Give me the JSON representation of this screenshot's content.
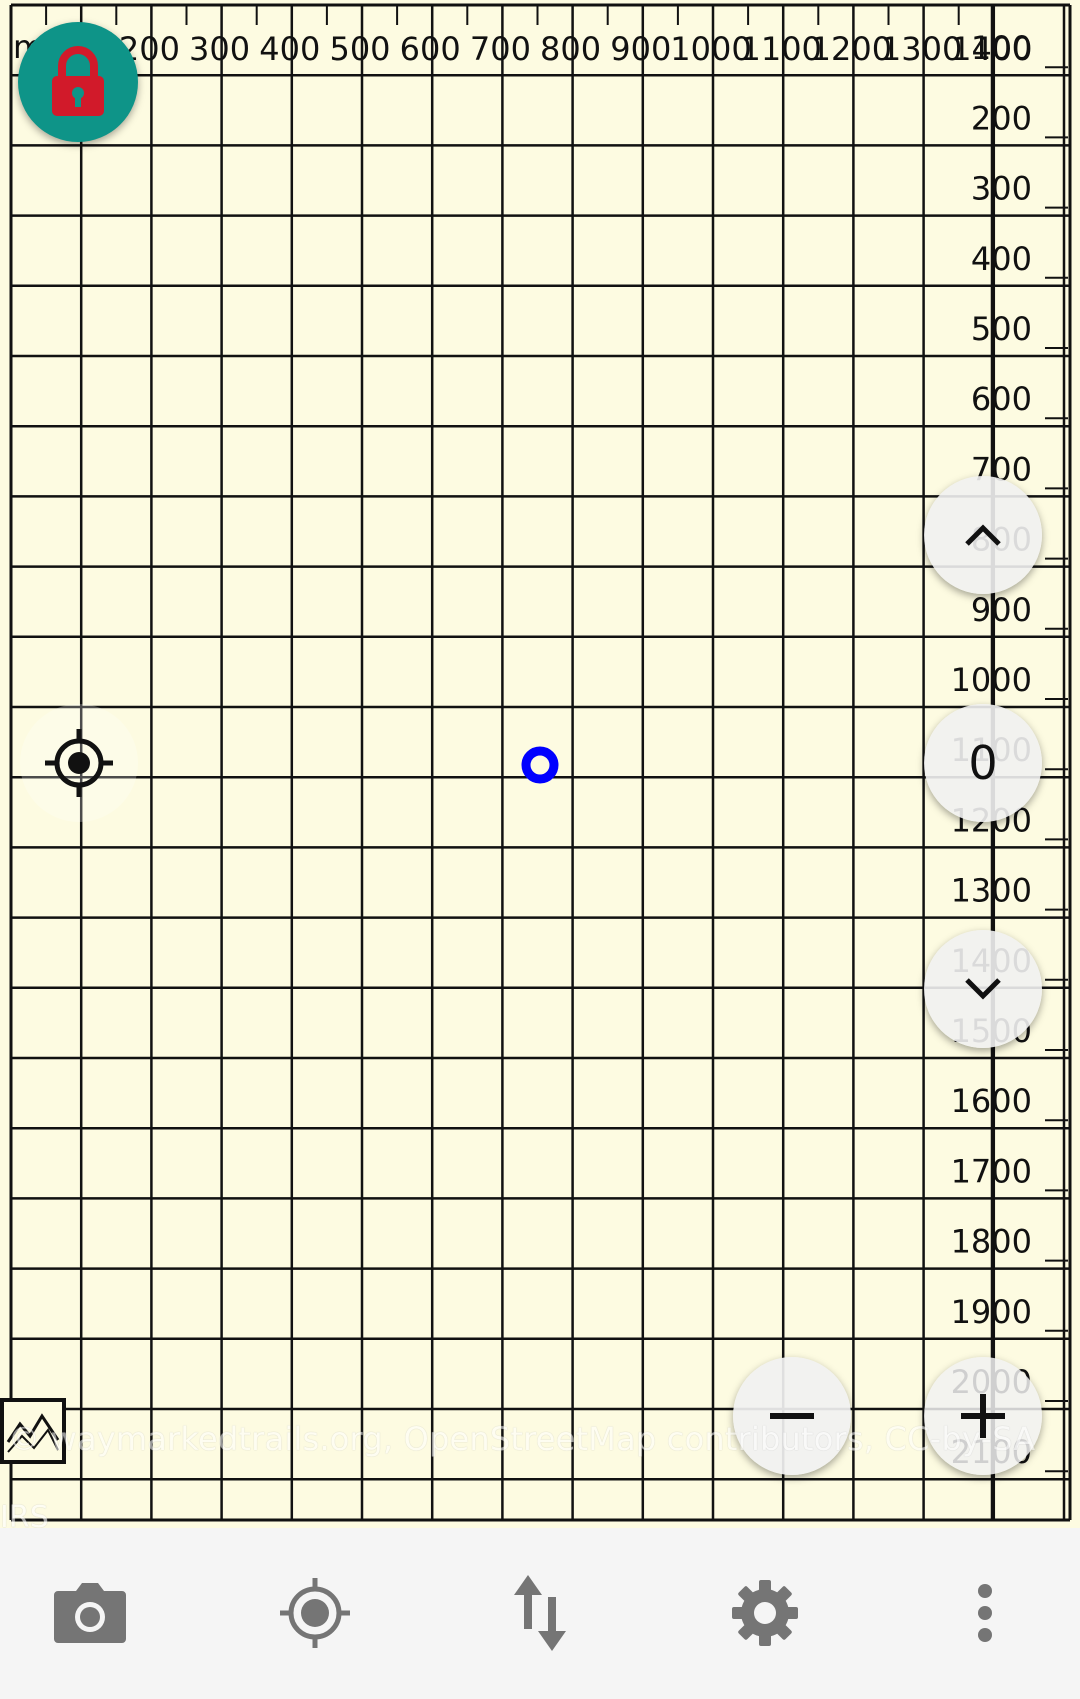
{
  "map": {
    "x_scale": {
      "unit_label": "m",
      "ticks": [
        "100",
        "200",
        "300",
        "400",
        "500",
        "600",
        "700",
        "800",
        "900",
        "1000",
        "1100",
        "1200",
        "1300",
        "1400"
      ]
    },
    "y_scale": {
      "ticks": [
        "100",
        "200",
        "300",
        "400",
        "500",
        "600",
        "700",
        "800",
        "900",
        "1000",
        "1100",
        "1200",
        "1300",
        "1400",
        "1500",
        "1600",
        "1700",
        "1800",
        "1900",
        "2000",
        "2100"
      ]
    },
    "attribution": "© waymarkedtrails.org, OpenStreetMap contributors, CC-by-SA",
    "corner_label": "IRS",
    "altitude_value": "0",
    "colors": {
      "background": "#fdfbe1",
      "grid": "#111111",
      "position_marker": "#0000ff",
      "lock_button": "#0e9488",
      "lock_icon": "#d11a2a"
    }
  },
  "buttons": {
    "lock": {
      "icon": "lock-icon"
    },
    "locate": {
      "icon": "crosshair-icon"
    },
    "altitude_up": {
      "icon": "chevron-up-icon"
    },
    "altitude_down": {
      "icon": "chevron-down-icon"
    },
    "zoom_out": {
      "icon": "minus-icon"
    },
    "zoom_in": {
      "icon": "plus-icon"
    },
    "layers": {
      "icon": "layers-icon"
    }
  },
  "bottom_bar": {
    "items": [
      {
        "id": "camera",
        "icon": "camera-icon"
      },
      {
        "id": "gps",
        "icon": "gps-icon"
      },
      {
        "id": "transfer",
        "icon": "swap-vertical-icon"
      },
      {
        "id": "settings",
        "icon": "gear-icon"
      },
      {
        "id": "more",
        "icon": "more-vert-icon"
      }
    ]
  }
}
